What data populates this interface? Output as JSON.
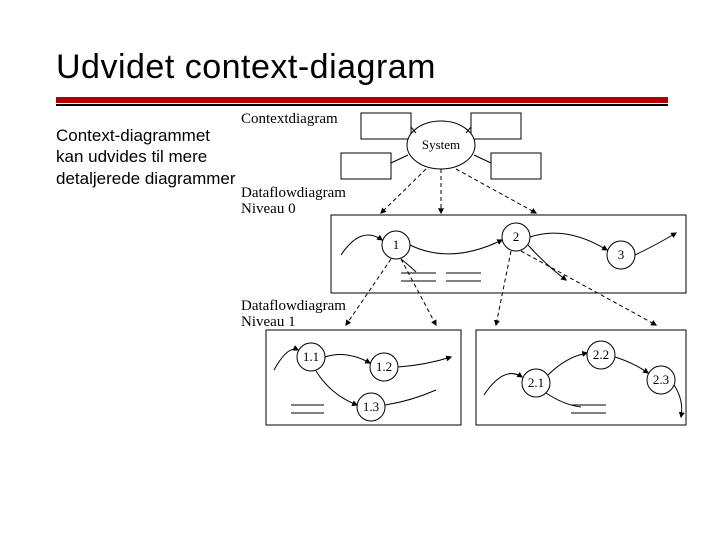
{
  "title": "Udvidet context-diagram",
  "description": "Context-diagrammet kan udvides til mere detaljerede diagrammer",
  "diagram": {
    "section1": "Contextdiagram",
    "system": "System",
    "section2a": "Dataflowdiagram",
    "section2b": "Niveau 0",
    "node1": "1",
    "node2": "2",
    "node3": "3",
    "section3a": "Dataflowdiagram",
    "section3b": "Niveau 1",
    "node11": "1.1",
    "node12": "1.2",
    "node13": "1.3",
    "node21": "2.1",
    "node22": "2.2",
    "node23": "2.3"
  }
}
